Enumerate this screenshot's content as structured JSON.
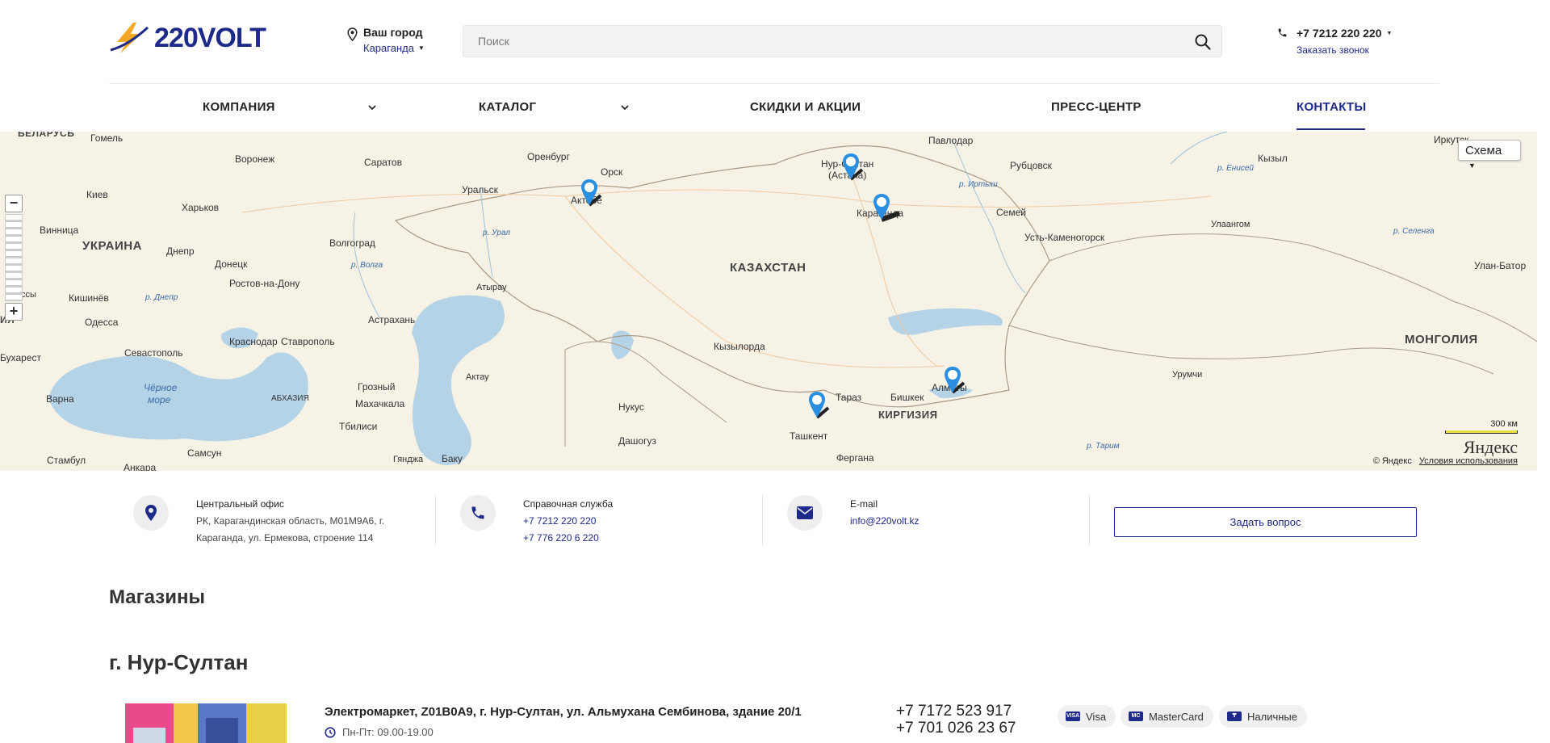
{
  "header": {
    "logo_text": "220VOLT",
    "city_label": "Ваш город",
    "city_name": "Караганда",
    "search_placeholder": "Поиск",
    "phone": "+7 7212 220 220",
    "callback": "Заказать звонок"
  },
  "nav": {
    "items": [
      {
        "label": "КОМПАНИЯ",
        "has_dropdown": true
      },
      {
        "label": "КАТАЛОГ",
        "has_dropdown": true
      },
      {
        "label": "СКИДКИ И АКЦИИ",
        "has_dropdown": false
      },
      {
        "label": "ПРЕСС-ЦЕНТР",
        "has_dropdown": false
      },
      {
        "label": "КОНТАКТЫ",
        "has_dropdown": false,
        "active": true
      }
    ]
  },
  "map": {
    "scheme_label": "Схема",
    "scale": "300 км",
    "provider": "Яндекс",
    "copyright": "© Яндекс",
    "terms": "Условия использования",
    "zoom_in": "+",
    "zoom_out": "−",
    "countries": [
      "КАЗАХСТАН",
      "УКРАИНА",
      "МОНГОЛИЯ",
      "КИРГИЗИЯ",
      "БЕЛАРУСЬ",
      "ИЯ"
    ],
    "cities": [
      "Гомель",
      "Воронеж",
      "Саратов",
      "Оренбург",
      "Орск",
      "Уральск",
      "Актобе",
      "Нур-Султан",
      "(Астана)",
      "Павлодар",
      "Рубцовск",
      "Караганда",
      "Семей",
      "Усть-Каменогорск",
      "Кызыл",
      "Иркутск",
      "Улаангом",
      "Улан-Батор",
      "Киев",
      "Харьков",
      "Винница",
      "Днепр",
      "Донецк",
      "Волгоград",
      "Ростов-на-Дону",
      "Атырау",
      "Кишинёв",
      "Одесса",
      "Яссы",
      "Астрахань",
      "Краснодар",
      "Ставрополь",
      "Севастополь",
      "Кызылорда",
      "Урумчи",
      "Бухарест",
      "Алматы",
      "Бишкек",
      "Тараз",
      "Ташкент",
      "Грозный",
      "Махачкала",
      "Актау",
      "Нукус",
      "Дашогуз",
      "Варна",
      "Тбилиси",
      "Баку",
      "Гянджа",
      "Самсун",
      "Стамбул",
      "Анкара",
      "Фергана",
      "АБХАЗИЯ"
    ],
    "waters": [
      "Чёрное",
      "море",
      "р. Урал",
      "р. Волга",
      "р. Днепр",
      "р. Иртыш",
      "р. Енисей",
      "р. Селенга",
      "р. Тарим"
    ]
  },
  "contacts": {
    "office": {
      "title": "Центральный офис",
      "line1": "РК, Карагандинская область, M01M9A6, г.",
      "line2": "Караганда, ул. Ермекова, строение 114"
    },
    "support": {
      "title": "Справочная служба",
      "phone1": "+7 7212 220 220",
      "phone2": "+7 776 220 6 220"
    },
    "email": {
      "title": "E-mail",
      "address": "info@220volt.kz"
    },
    "ask_button": "Задать вопрос"
  },
  "stores_title": "Магазины",
  "city_title": "г. Нур-Султан",
  "store": {
    "address": "Электромаркет, Z01B0A9, г. Нур-Султан, ул. Альмухана Сембинова, здание 20/1",
    "hours": "Пн-Пт: 09.00-19.00",
    "phone1": "+7 7172 523 917",
    "phone2": "+7 701 026 23 67",
    "payments": [
      {
        "label": "Visa",
        "icon": "VISA"
      },
      {
        "label": "MasterCard",
        "icon": "MC"
      },
      {
        "label": "Наличные",
        "icon": "₸"
      }
    ]
  },
  "colors": {
    "brand": "#1e2a8a",
    "logo_accent": "#f5a623",
    "map_bg": "#f6f2e6",
    "water": "#b5d3e7",
    "marker": "#2a8fe0"
  }
}
